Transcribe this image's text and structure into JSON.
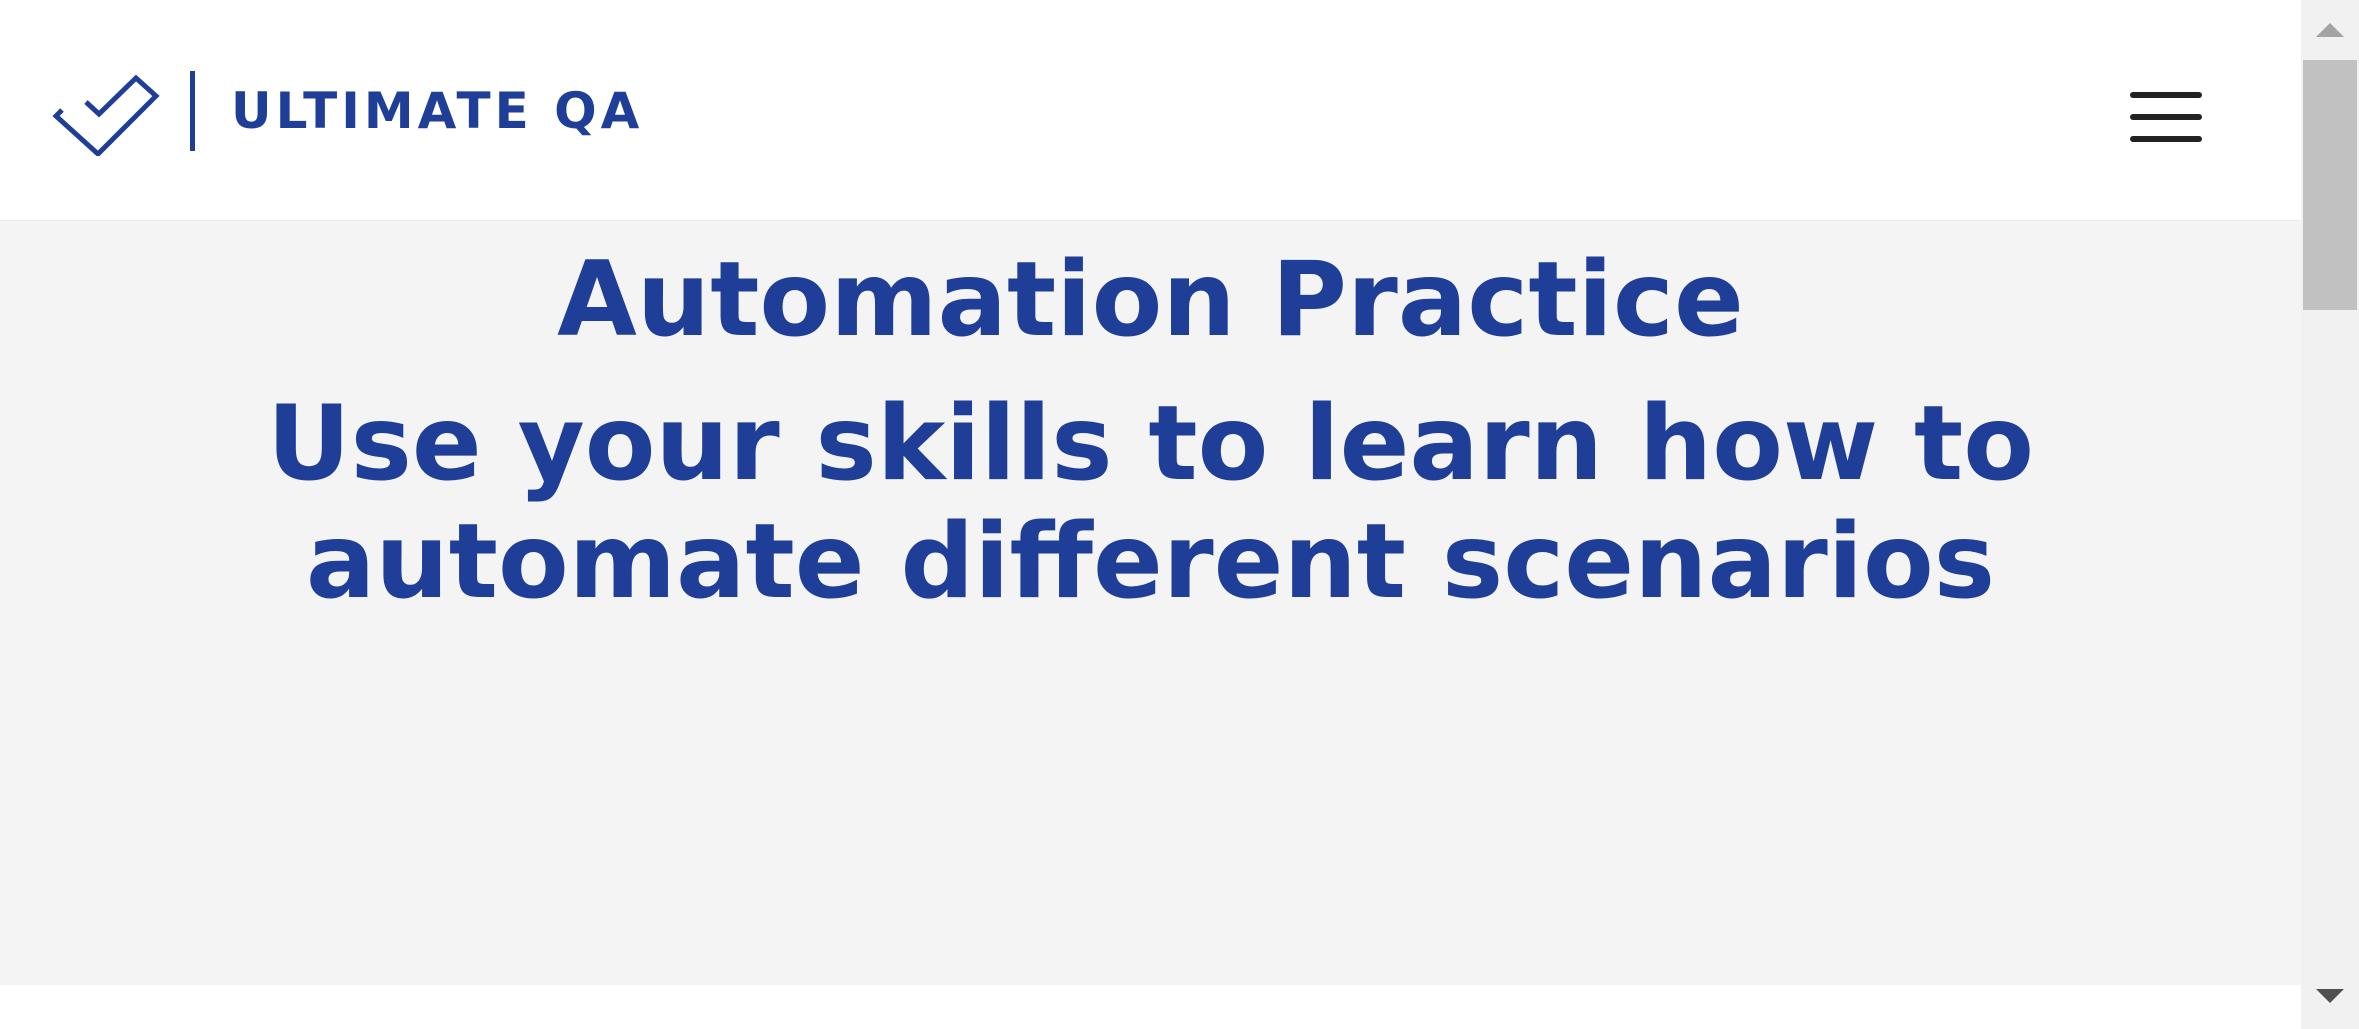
{
  "header": {
    "logo_text": "ULTIMATE QA",
    "menu_icon": "hamburger-menu-icon",
    "logo_icon": "checkmark-logo-icon",
    "brand_color": "#1f3e97"
  },
  "hero": {
    "title": "Automation Practice",
    "subtitle": "Use your skills to learn how to automate different scenarios",
    "background_color": "#f4f4f4",
    "text_color": "#1f3e97"
  },
  "scrollbar": {
    "up_icon": "scroll-up-arrow-icon",
    "down_icon": "scroll-down-arrow-icon"
  }
}
